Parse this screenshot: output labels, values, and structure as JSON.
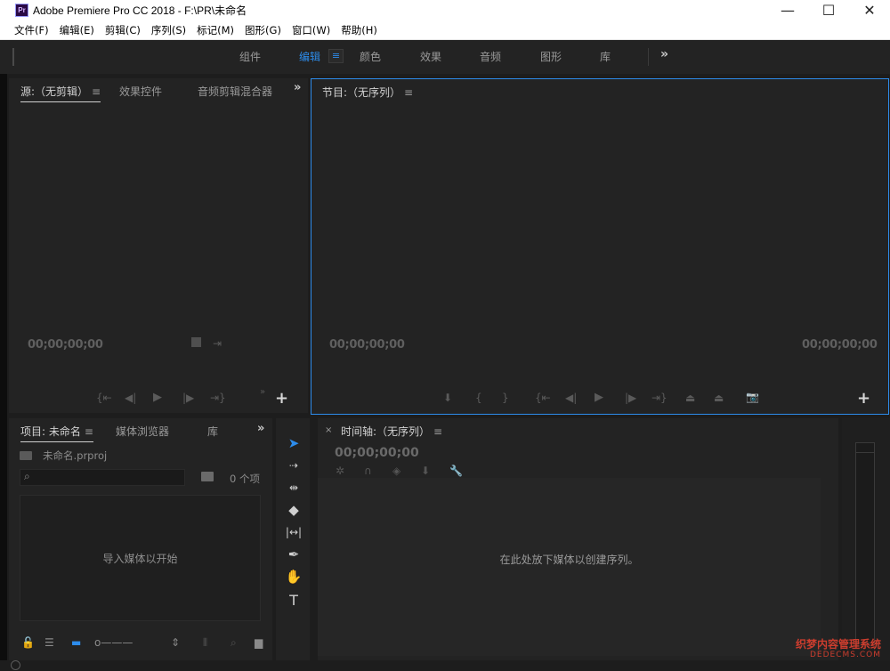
{
  "window": {
    "app_icon_text": "Pr",
    "title": "Adobe Premiere Pro CC 2018 - F:\\PR\\未命名",
    "minimize": "—",
    "maximize": "☐",
    "close": "✕"
  },
  "menubar": [
    "文件(F)",
    "编辑(E)",
    "剪辑(C)",
    "序列(S)",
    "标记(M)",
    "图形(G)",
    "窗口(W)",
    "帮助(H)"
  ],
  "workspaces": {
    "tabs": [
      "组件",
      "编辑",
      "颜色",
      "效果",
      "音频",
      "图形",
      "库"
    ],
    "active": "编辑",
    "menu_icon": "≡",
    "more": "»"
  },
  "source_panel": {
    "tabs": [
      "源:（无剪辑）",
      "效果控件",
      "音频剪辑混合器"
    ],
    "menu_icon": "≡",
    "more": "»",
    "timecode": "00;00;00;00",
    "add": "+"
  },
  "program_panel": {
    "tab": "节目:（无序列）",
    "menu_icon": "≡",
    "timecode_left": "00;00;00;00",
    "timecode_right": "00;00;00;00",
    "add": "+"
  },
  "project_panel": {
    "tabs": [
      "项目: 未命名",
      "媒体浏览器",
      "库"
    ],
    "menu_icon": "≡",
    "more": "»",
    "file_name": "未命名.prproj",
    "item_count": "0 个项",
    "drop_hint": "导入媒体以开始"
  },
  "timeline_panel": {
    "close": "×",
    "tab": "时间轴:（无序列）",
    "menu_icon": "≡",
    "timecode": "00;00;00;00",
    "drop_hint": "在此处放下媒体以创建序列。"
  },
  "tools": [
    "selection-tool",
    "track-select-tool",
    "ripple-edit-tool",
    "razor-tool",
    "slip-tool",
    "pen-tool",
    "hand-tool",
    "type-tool"
  ],
  "watermark": {
    "line1": "织梦内容管理系统",
    "line2": "DEDECMS.COM"
  },
  "colors": {
    "accent": "#2d8ceb",
    "panel_bg": "#232323",
    "app_bg": "#1d1d1d"
  }
}
